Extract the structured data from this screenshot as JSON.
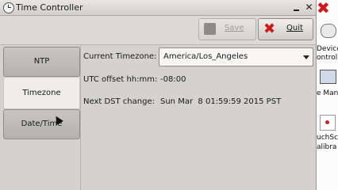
{
  "window": {
    "title": "Time Controller",
    "minimize_label": "",
    "close_label": "✕"
  },
  "toolbar": {
    "save_label": "Save",
    "save_disabled": true,
    "quit_label": "Quit"
  },
  "tabs": [
    {
      "label": "NTP",
      "selected": false
    },
    {
      "label": "Timezone",
      "selected": true
    },
    {
      "label": "Date/Time",
      "selected": false
    }
  ],
  "timezone": {
    "current_label": "Current Timezone:",
    "current_value": "America/Los_Angeles",
    "utc_label": "UTC offset hh:mm:",
    "utc_value": "-08:00",
    "dst_label": "Next DST change:",
    "dst_value": "Sun Mar  8 01:59:59 2015 PST"
  },
  "desktop": {
    "items": [
      {
        "label": "Device",
        "label2": "ontrol"
      },
      {
        "label": "e Man"
      },
      {
        "label": "uchSc",
        "label2": "alibra"
      }
    ]
  },
  "colors": {
    "quit_icon": "#d01818",
    "selected_tab": "#eeedea",
    "tab": "#bebcb8"
  }
}
